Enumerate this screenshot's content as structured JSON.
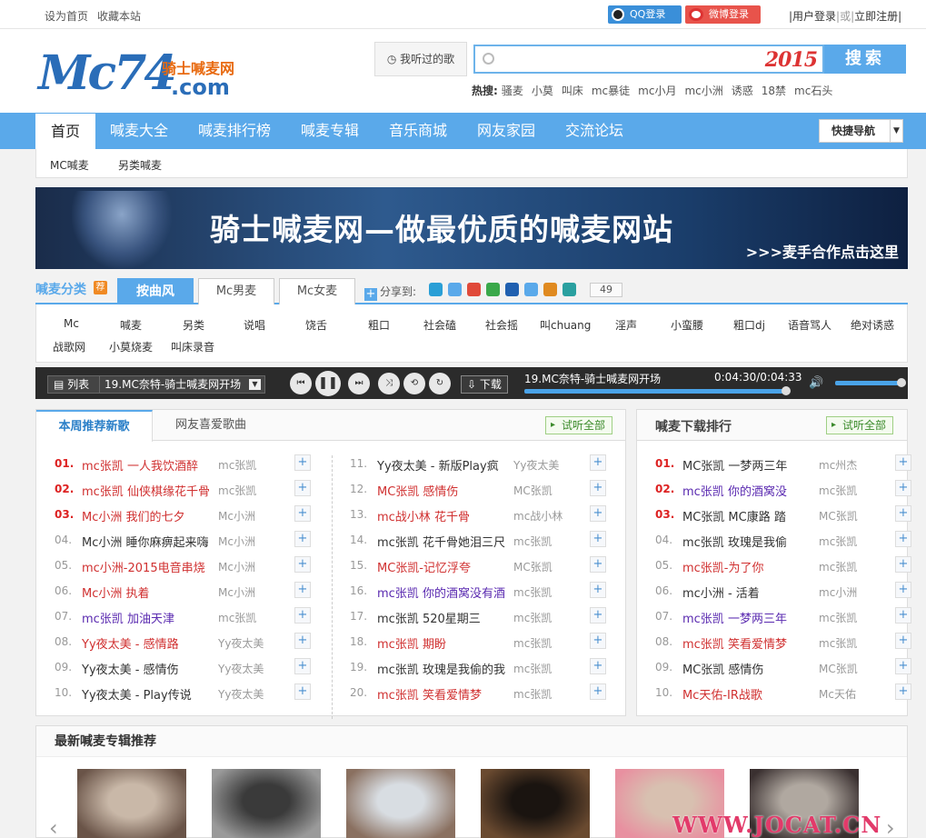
{
  "topbar": {
    "set_home": "设为首页",
    "bookmark": "收藏本站",
    "qq_login": "QQ登录",
    "weibo_login": "微博登录",
    "user_login": "|用户登录",
    "or": "|或|",
    "register": "立即注册|"
  },
  "header": {
    "logo_mc": "Mc74",
    "logo_sub": "骑士喊麦网",
    "logo_com": ".com",
    "heard_songs": "我听过的歌",
    "search_placeholder": "",
    "search_badge": "2015",
    "search_button": "搜索",
    "hot_label": "热搜:",
    "hot_terms": [
      "骚麦",
      "小莫",
      "叫床",
      "mc暴徒",
      "mc小月",
      "mc小洲",
      "诱惑",
      "18禁",
      "mc石头"
    ]
  },
  "nav": {
    "items": [
      "首页",
      "喊麦大全",
      "喊麦排行榜",
      "喊麦专辑",
      "音乐商城",
      "网友家园",
      "交流论坛"
    ],
    "quick_nav": "快捷导航"
  },
  "subnav": [
    "MC喊麦",
    "另类喊麦"
  ],
  "banner": {
    "title": "骑士喊麦网—做最优质的喊麦网站",
    "link": ">>>麦手合作点击这里"
  },
  "category": {
    "label": "喊麦分类",
    "badge": "荐",
    "tabs": [
      "按曲风",
      "Mc男麦",
      "Mc女麦"
    ],
    "share_label": "分享到:",
    "share_count": "49",
    "share_colors": [
      "#2a9fd6",
      "#5aa9ea",
      "#e04a3a",
      "#3aa84a",
      "#2060b0",
      "#5aa9ea",
      "#e08a20",
      "#2aa0a0"
    ],
    "row1": [
      "Mc",
      "喊麦",
      "另类",
      "说唱",
      "饶舌",
      "粗口",
      "社会磕",
      "社会摇",
      "叫chuang",
      "淫声",
      "小蛮腰",
      "粗口dj",
      "语音骂人",
      "绝对诱惑"
    ],
    "row2": [
      "战歌网",
      "小莫烧麦",
      "叫床录音"
    ]
  },
  "player": {
    "list_label": "列表",
    "current": "19.MC奈特-骑士喊麦网开场",
    "download": "下载",
    "title": "19.MC奈特-骑士喊麦网开场",
    "time": "0:04:30/0:04:33",
    "progress": 0.99,
    "volume": 0.95
  },
  "weekly": {
    "tabs": [
      "本周推荐新歌",
      "网友喜爱歌曲"
    ],
    "view_all": "试听全部",
    "left": [
      {
        "n": "01.",
        "t": "mc张凯 一人我饮酒醉",
        "s": "mc张凯",
        "c": "red"
      },
      {
        "n": "02.",
        "t": "mc张凯 仙侠棋缘花千骨",
        "s": "mc张凯",
        "c": "red"
      },
      {
        "n": "03.",
        "t": "Mc小洲 我们的七夕",
        "s": "Mc小洲",
        "c": "red"
      },
      {
        "n": "04.",
        "t": "Mc小洲 睡你麻痹起来嗨",
        "s": "Mc小洲",
        "c": "blk"
      },
      {
        "n": "05.",
        "t": "mc小洲-2015电音串烧",
        "s": "Mc小洲",
        "c": "red"
      },
      {
        "n": "06.",
        "t": "Mc小洲 执着",
        "s": "Mc小洲",
        "c": "red"
      },
      {
        "n": "07.",
        "t": "mc张凯 加油天津",
        "s": "mc张凯",
        "c": "pur"
      },
      {
        "n": "08.",
        "t": "Yy夜太美 - 感情路",
        "s": "Yy夜太美",
        "c": "red"
      },
      {
        "n": "09.",
        "t": "Yy夜太美 - 感情伤",
        "s": "Yy夜太美",
        "c": "blk"
      },
      {
        "n": "10.",
        "t": "Yy夜太美 - Play传说",
        "s": "Yy夜太美",
        "c": "blk"
      }
    ],
    "right": [
      {
        "n": "11.",
        "t": "Yy夜太美 - 新版Play疯",
        "s": "Yy夜太美",
        "c": "blk"
      },
      {
        "n": "12.",
        "t": "MC张凯 感情伤",
        "s": "MC张凯",
        "c": "red"
      },
      {
        "n": "13.",
        "t": "mc战小林 花千骨",
        "s": "mc战小林",
        "c": "red"
      },
      {
        "n": "14.",
        "t": "mc张凯 花千骨她泪三尺",
        "s": "mc张凯",
        "c": "blk"
      },
      {
        "n": "15.",
        "t": "MC张凯-记忆浮夸",
        "s": "MC张凯",
        "c": "red"
      },
      {
        "n": "16.",
        "t": "mc张凯 你的酒窝没有酒",
        "s": "mc张凯",
        "c": "pur"
      },
      {
        "n": "17.",
        "t": "mc张凯 520星期三",
        "s": "mc张凯",
        "c": "blk"
      },
      {
        "n": "18.",
        "t": "mc张凯 期盼",
        "s": "mc张凯",
        "c": "red"
      },
      {
        "n": "19.",
        "t": "mc张凯 玫瑰是我偷的我",
        "s": "mc张凯",
        "c": "blk"
      },
      {
        "n": "20.",
        "t": "mc张凯 笑看爱情梦",
        "s": "mc张凯",
        "c": "red"
      }
    ]
  },
  "ranking": {
    "title": "喊麦下载排行",
    "view_all": "试听全部",
    "items": [
      {
        "n": "01.",
        "t": "MC张凯 一梦两三年",
        "s": "mc州杰",
        "c": "blk"
      },
      {
        "n": "02.",
        "t": "mc张凯 你的酒窝没",
        "s": "mc张凯",
        "c": "pur"
      },
      {
        "n": "03.",
        "t": "MC张凯 MC康路 踏",
        "s": "MC张凯",
        "c": "blk"
      },
      {
        "n": "04.",
        "t": "mc张凯 玫瑰是我偷",
        "s": "mc张凯",
        "c": "blk"
      },
      {
        "n": "05.",
        "t": "mc张凯-为了你",
        "s": "mc张凯",
        "c": "red"
      },
      {
        "n": "06.",
        "t": "mc小洲 - 活着",
        "s": "mc小洲",
        "c": "blk"
      },
      {
        "n": "07.",
        "t": "mc张凯 一梦两三年",
        "s": "mc张凯",
        "c": "pur"
      },
      {
        "n": "08.",
        "t": "mc张凯 笑看爱情梦",
        "s": "mc张凯",
        "c": "red"
      },
      {
        "n": "09.",
        "t": "MC张凯 感情伤",
        "s": "MC张凯",
        "c": "blk"
      },
      {
        "n": "10.",
        "t": "Mc天佑-IR战歌",
        "s": "Mc天佑",
        "c": "red"
      }
    ]
  },
  "albums": {
    "title": "最新喊麦专辑推荐",
    "thumb_colors": [
      [
        "#c9b8a8",
        "#6a5448"
      ],
      [
        "#3a3a3a",
        "#9a9a9a"
      ],
      [
        "#d8dde2",
        "#8a7060"
      ],
      [
        "#1a1410",
        "#6a4a30"
      ],
      [
        "#d8c0b0",
        "#e890a0"
      ],
      [
        "#b0a8a0",
        "#3a3030"
      ]
    ]
  },
  "watermark": "WWW.JOCAT.CN"
}
